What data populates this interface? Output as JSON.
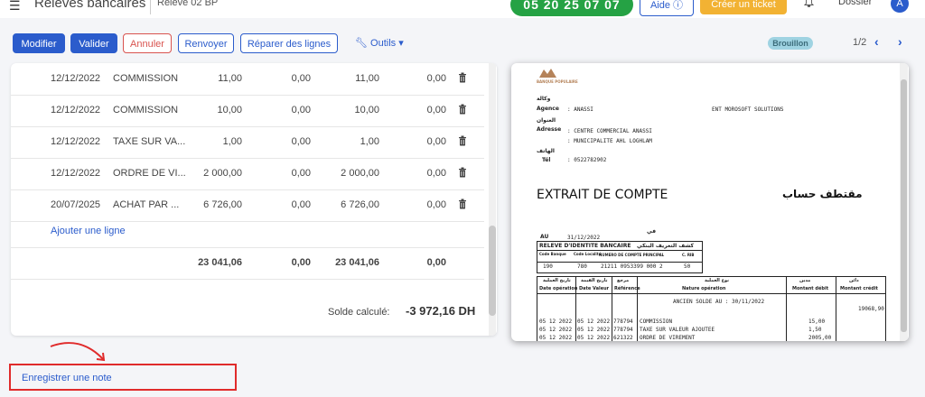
{
  "header": {
    "app_title": "Relevés bancaires",
    "subtitle": "Relevé 02 BP",
    "phone": "05 20 25 07 07",
    "aide_label": "Aide ⓘ",
    "ticket_label": "Créer un ticket",
    "dossier_label": "Dossier",
    "avatar_letter": "A"
  },
  "toolbar": {
    "modifier": "Modifier",
    "valider": "Valider",
    "annuler": "Annuler",
    "renvoyer": "Renvoyer",
    "reparer": "Réparer des lignes",
    "outils": "Outils ▾",
    "status_badge": "Brouillon",
    "pager": "1/2"
  },
  "table": {
    "rows": [
      {
        "date": "12/12/2022",
        "label": "COMMISSION",
        "c1": "11,00",
        "c2": "0,00",
        "c3": "11,00",
        "c4": "0,00"
      },
      {
        "date": "12/12/2022",
        "label": "COMMISSION",
        "c1": "10,00",
        "c2": "0,00",
        "c3": "10,00",
        "c4": "0,00"
      },
      {
        "date": "12/12/2022",
        "label": "TAXE SUR VA...",
        "c1": "1,00",
        "c2": "0,00",
        "c3": "1,00",
        "c4": "0,00"
      },
      {
        "date": "12/12/2022",
        "label": "ORDRE DE VI...",
        "c1": "2 000,00",
        "c2": "0,00",
        "c3": "2 000,00",
        "c4": "0,00"
      },
      {
        "date": "20/07/2025",
        "label": "ACHAT PAR ...",
        "c1": "6 726,00",
        "c2": "0,00",
        "c3": "6 726,00",
        "c4": "0,00"
      }
    ],
    "add_line": "Ajouter une ligne",
    "totals": {
      "t1": "23 041,06",
      "t2": "0,00",
      "t3": "23 041,06",
      "t4": "0,00"
    },
    "solde_label": "Solde calculé:",
    "solde_value": "-3 972,16 DH"
  },
  "document": {
    "bank_name": "BANQUE POPULAIRE",
    "agence_ar": "وكالة",
    "agence_label": "Agence",
    "agence_value": ": ANASSI",
    "client": "ENT  MOROSOFT SOLUTIONS",
    "adresse_ar": "العنوان",
    "adresse_label": "Adresse",
    "adresse_line1": ": CENTRE COMMERCIAL ANASSI",
    "adresse_line2": ": MUNICIPALITE AHL LOGHLAM",
    "tel_ar": "الهاتف",
    "tel_label": "Tél",
    "tel_value": ": 0522782902",
    "title": "EXTRAIT DE COMPTE",
    "title_ar": "مقتطف حساب",
    "au_label": "AU",
    "au_date": "31/12/2022",
    "au_ar": "في",
    "rib_label": "RELEVE D'IDENTITE BANCAIRE",
    "rib_ar": "كشف التعريف البنكي",
    "code_banque": "Code Banque",
    "code_localite": "Code Localité",
    "num_compte": "NUMERO DE COMPTE PRINCIPAL",
    "cle_rib": "C. RIB",
    "rib_values": [
      "190",
      "780",
      "21211 0953399 000 2",
      "50"
    ],
    "col_ar": [
      "تاريخ العملية",
      "تاريخ القيمة",
      "مرجع",
      "نوع العملية",
      "مدين",
      "دائن"
    ],
    "col_date_op": "Date opération",
    "col_date_val": "Date Valeur",
    "col_ref": "Référence",
    "col_nature": "Nature opération",
    "col_debit": "Montant débit",
    "col_credit": "Montant crédit",
    "ancien_solde": "ANCIEN  SOLDE AU : 30/11/2022",
    "ancien_solde_value": "19068,90",
    "doc_rows": [
      {
        "d1": "05 12 2022",
        "d2": "05 12 2022",
        "ref": "778794",
        "nature": "COMMISSION",
        "debit": "15,00"
      },
      {
        "d1": "05 12 2022",
        "d2": "05 12 2022",
        "ref": "778794",
        "nature": "TAXE SUR VALEUR AJOUTEE",
        "debit": "1,50"
      },
      {
        "d1": "05 12 2022",
        "d2": "05 12 2022",
        "ref": "621322",
        "nature": "ORDRE DE VIREMENT",
        "debit": "2005,00"
      }
    ]
  },
  "note": {
    "link_label": "Enregistrer une note"
  },
  "colors": {
    "primary": "#2b5ccc",
    "phone_green": "#25a244",
    "ticket_orange": "#f2b233",
    "danger": "#d9534f",
    "badge": "#9fd3e2",
    "highlight_red": "#e02b2b"
  }
}
